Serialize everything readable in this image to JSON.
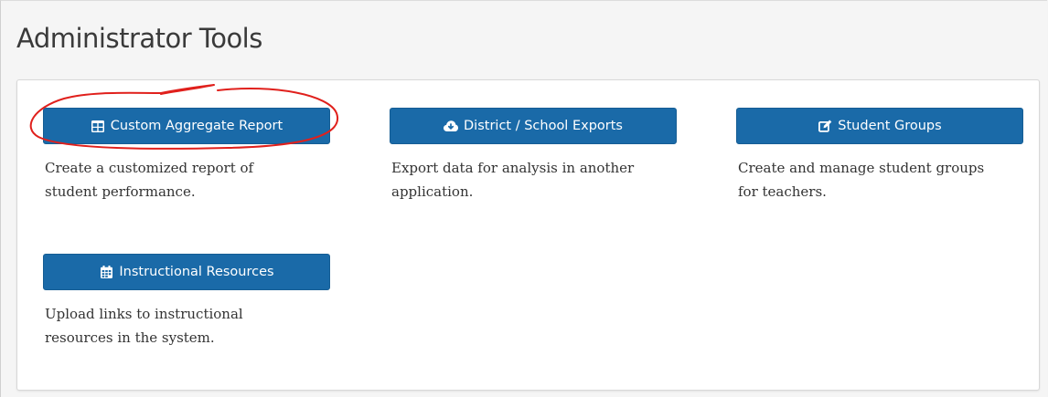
{
  "page": {
    "title": "Administrator Tools"
  },
  "tools": [
    {
      "label": "Custom Aggregate Report",
      "icon": "table-icon",
      "description_line1": "Create a customized report of",
      "description_line2": "student performance."
    },
    {
      "label": "District / School Exports",
      "icon": "cloud-download-icon",
      "description_line1": "Export data for analysis in another",
      "description_line2": "application."
    },
    {
      "label": "Student Groups",
      "icon": "edit-icon",
      "description_line1": "Create and manage student groups",
      "description_line2": "for teachers."
    },
    {
      "label": "Instructional Resources",
      "icon": "calendar-icon",
      "description_line1": "Upload links to instructional",
      "description_line2": "resources in the system."
    }
  ],
  "colors": {
    "button_bg": "#1a6aa8",
    "annotation": "#e0201c"
  }
}
